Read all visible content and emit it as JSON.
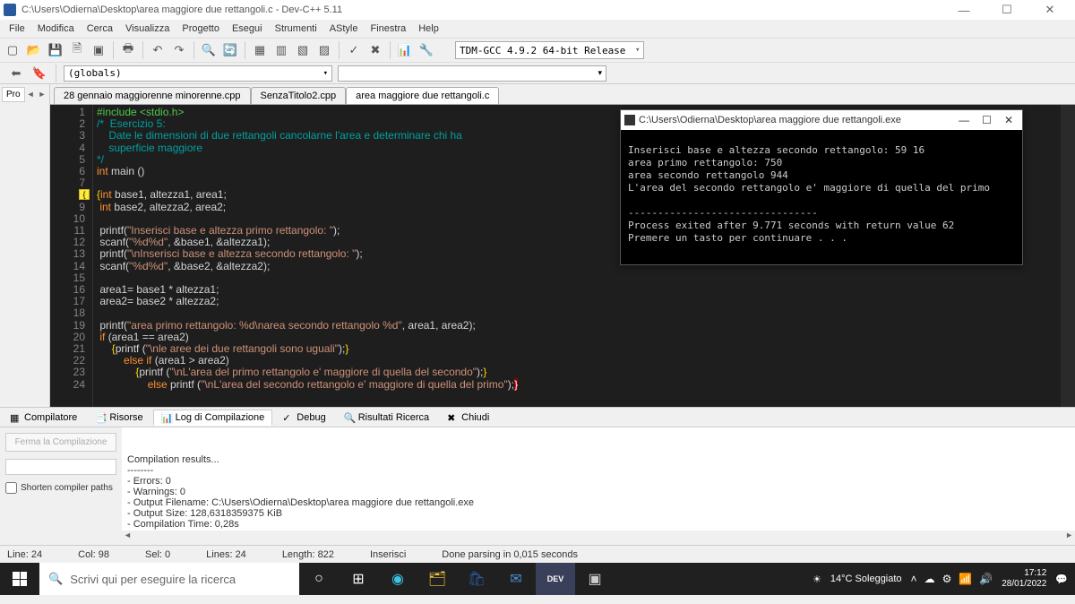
{
  "window": {
    "title": "C:\\Users\\Odierna\\Desktop\\area maggiore due rettangoli.c - Dev-C++ 5.11"
  },
  "menus": [
    "File",
    "Modifica",
    "Cerca",
    "Visualizza",
    "Progetto",
    "Esegui",
    "Strumenti",
    "AStyle",
    "Finestra",
    "Help"
  ],
  "compiler_combo": "TDM-GCC 4.9.2 64-bit Release",
  "globals_combo": "(globals)",
  "side_tab": "Pro",
  "file_tabs": [
    {
      "label": "28 gennaio maggiorenne minorenne.cpp",
      "active": false
    },
    {
      "label": "SenzaTitolo2.cpp",
      "active": false
    },
    {
      "label": "area maggiore due rettangoli.c",
      "active": true
    }
  ],
  "code_lines": [
    {
      "n": 1,
      "html": "<span class='c-inc'>#include &lt;stdio.h&gt;</span>"
    },
    {
      "n": 2,
      "html": "<span class='c-cmt'>/*  Esercizio 5:</span>"
    },
    {
      "n": 3,
      "html": "<span class='c-cmt'>    Date le dimensioni di due rettangoli cancolarne l'area e determinare chi ha</span>"
    },
    {
      "n": 4,
      "html": "<span class='c-cmt'>    superficie maggiore</span>"
    },
    {
      "n": 5,
      "html": "<span class='c-cmt'>*/</span>"
    },
    {
      "n": 6,
      "html": "<span class='c-kw'>int</span> <span class='c-txt'>main ()</span>"
    },
    {
      "n": 7,
      "html": ""
    },
    {
      "n": 8,
      "html": "<span class='c-brace'>{</span><span class='c-kw'>int</span> <span class='c-txt'>base1, altezza1, area1;</span>"
    },
    {
      "n": 9,
      "html": " <span class='c-kw'>int</span> <span class='c-txt'>base2, altezza2, area2;</span>"
    },
    {
      "n": 10,
      "html": ""
    },
    {
      "n": 11,
      "html": " <span class='c-txt'>printf(</span><span class='c-str'>\"Inserisci base e altezza primo rettangolo: \"</span><span class='c-txt'>);</span>"
    },
    {
      "n": 12,
      "html": " <span class='c-txt'>scanf(</span><span class='c-str'>\"%d%d\"</span><span class='c-txt'>, &amp;base1, &amp;altezza1);</span>"
    },
    {
      "n": 13,
      "html": " <span class='c-txt'>printf(</span><span class='c-str'>\"\\nInserisci base e altezza secondo rettangolo: \"</span><span class='c-txt'>);</span>"
    },
    {
      "n": 14,
      "html": " <span class='c-txt'>scanf(</span><span class='c-str'>\"%d%d\"</span><span class='c-txt'>, &amp;base2, &amp;altezza2);</span>"
    },
    {
      "n": 15,
      "html": ""
    },
    {
      "n": 16,
      "html": " <span class='c-txt'>area1= base1 * altezza1;</span>"
    },
    {
      "n": 17,
      "html": " <span class='c-txt'>area2= base2 * altezza2;</span>"
    },
    {
      "n": 18,
      "html": ""
    },
    {
      "n": 19,
      "html": " <span class='c-txt'>printf(</span><span class='c-str'>\"area primo rettangolo: %d\\narea secondo rettangolo %d\"</span><span class='c-txt'>, area1, area2);</span>"
    },
    {
      "n": 20,
      "html": " <span class='c-kw'>if</span> <span class='c-txt'>(area1 == area2)</span>"
    },
    {
      "n": 21,
      "html": "     <span class='c-brace'>{</span><span class='c-txt'>printf (</span><span class='c-str'>\"\\nle aree dei due rettangoli sono uguali\"</span><span class='c-txt'>);</span><span class='c-brace'>}</span>"
    },
    {
      "n": 22,
      "html": "         <span class='c-kw'>else if</span> <span class='c-txt'>(area1 &gt; area2)</span>"
    },
    {
      "n": 23,
      "html": "             <span class='c-brace'>{</span><span class='c-txt'>printf (</span><span class='c-str'>\"\\nL'area del primo rettangolo e' maggiore di quella del secondo\"</span><span class='c-txt'>);</span><span class='c-brace'>}</span>"
    },
    {
      "n": 24,
      "html": "                 <span class='c-kw'>else</span> <span class='c-txt'>printf (</span><span class='c-str'>\"\\nL'area del secondo rettangolo e' maggiore di quella del primo\"</span><span class='c-txt'>);</span><span class='c-redbg'>}</span>"
    }
  ],
  "console": {
    "title": "C:\\Users\\Odierna\\Desktop\\area maggiore due rettangoli.exe",
    "body": "Inserisci base e altezza secondo rettangolo: 59 16\narea primo rettangolo: 750\narea secondo rettangolo 944\nL'area del secondo rettangolo e' maggiore di quella del primo\n\n--------------------------------\nProcess exited after 9.771 seconds with return value 62\nPremere un tasto per continuare . . ."
  },
  "bottom_tabs": [
    {
      "icon": "grid",
      "label": "Compilatore"
    },
    {
      "icon": "res",
      "label": "Risorse"
    },
    {
      "icon": "log",
      "label": "Log di Compilazione",
      "active": true
    },
    {
      "icon": "debug",
      "label": "Debug"
    },
    {
      "icon": "search",
      "label": "Risultati Ricerca"
    },
    {
      "icon": "close",
      "label": "Chiudi"
    }
  ],
  "bottom_left": {
    "btn": "Ferma la Compilazione",
    "check": "Shorten compiler paths"
  },
  "compile_log": "Compilation results...\n--------\n- Errors: 0\n- Warnings: 0\n- Output Filename: C:\\Users\\Odierna\\Desktop\\area maggiore due rettangoli.exe\n- Output Size: 128,6318359375 KiB\n- Compilation Time: 0,28s",
  "status": {
    "line": "Line:  24",
    "col": "Col:  98",
    "sel": "Sel:  0",
    "lines": "Lines:  24",
    "length": "Length:  822",
    "mode": "Inserisci",
    "parse": "Done parsing in 0,015 seconds"
  },
  "taskbar": {
    "search_placeholder": "Scrivi qui per eseguire la ricerca",
    "weather": "14°C Soleggiato",
    "time": "17:12",
    "date": "28/01/2022"
  }
}
